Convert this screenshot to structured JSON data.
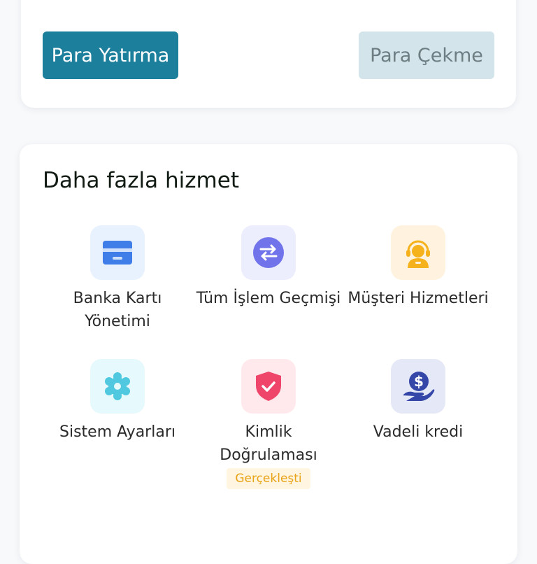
{
  "actions": {
    "deposit_label": "Para Yatırma",
    "withdraw_label": "Para Çekme"
  },
  "services": {
    "title": "Daha fazla hizmet",
    "items": [
      {
        "label_line1": "Banka Kartı",
        "label_line2": "Yönetimi",
        "icon": "bank-card-icon",
        "icon_bg": "#e8f1fe",
        "icon_color": "#3f7ee8"
      },
      {
        "label_line1": "Tüm İşlem Geçmişi",
        "icon": "exchange-icon",
        "icon_bg": "#eceefd",
        "icon_color": "#6b6ee8"
      },
      {
        "label_line1": "Müşteri Hizmetleri",
        "icon": "customer-service-icon",
        "icon_bg": "#fff3df",
        "icon_color": "#f5b21c"
      },
      {
        "label_line1": "Sistem Ayarları",
        "icon": "gear-icon",
        "icon_bg": "#e6f9fc",
        "icon_color": "#4fc8e0"
      },
      {
        "label_line1": "Kimlik",
        "label_line2": "Doğrulaması",
        "badge": "Gerçekleşti",
        "icon": "shield-check-icon",
        "icon_bg": "#ffe9ed",
        "icon_color": "#f0456a"
      },
      {
        "label_line1": "Vadeli kredi",
        "icon": "dollar-hand-icon",
        "icon_bg": "#e5e8f6",
        "icon_color": "#3446a8"
      }
    ]
  }
}
